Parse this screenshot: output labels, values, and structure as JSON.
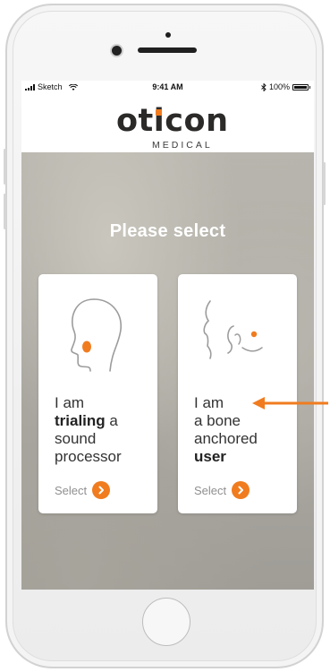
{
  "status_bar": {
    "carrier": "Sketch",
    "time": "9:41 AM",
    "battery_percent": "100%"
  },
  "brand": {
    "logo_text": "oticon",
    "logo_subtext": "MEDICAL",
    "accent_color": "#f07c1f"
  },
  "hero": {
    "title": "Please select"
  },
  "cards": [
    {
      "line1": "I am",
      "line2_bold": "trialing",
      "line2_rest": " a",
      "line3": "sound",
      "line4": "processor",
      "select_label": "Select",
      "icon": "head-profile-icon"
    },
    {
      "line1": "I am",
      "line2": "a bone",
      "line3": "anchored",
      "line4_bold": "user",
      "select_label": "Select",
      "icon": "ear-implant-icon"
    }
  ]
}
